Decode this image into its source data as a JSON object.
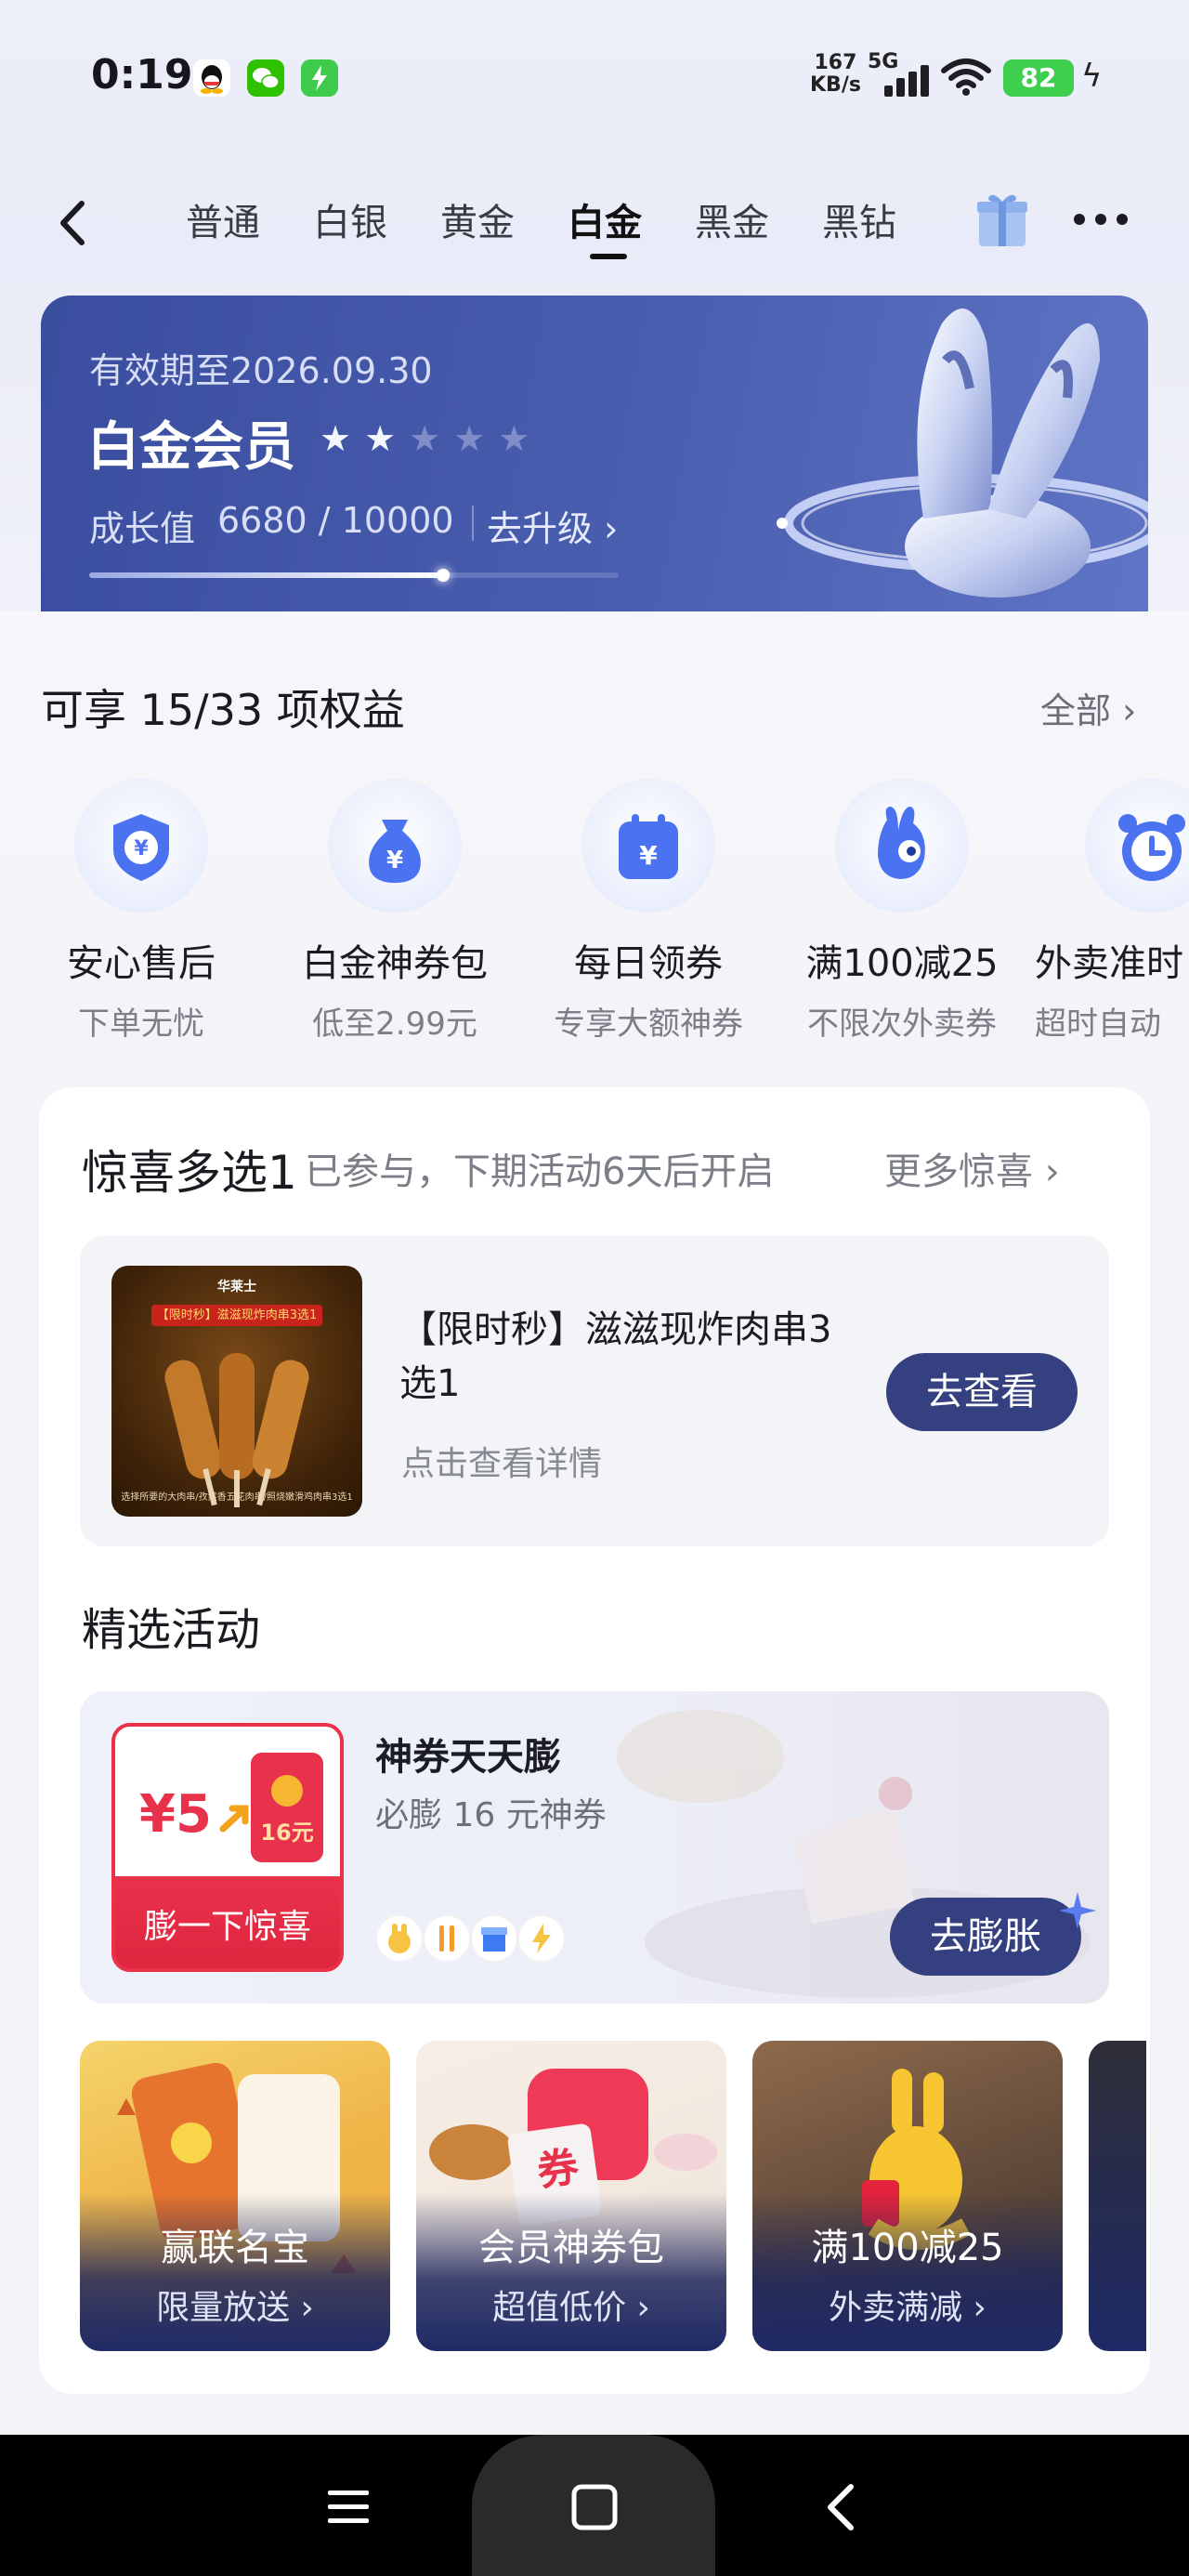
{
  "status_bar": {
    "time": "0:19",
    "net_speed_value": "167",
    "net_speed_unit": "KB/s",
    "network": "5G",
    "battery": "82"
  },
  "nav": {
    "tabs": [
      {
        "label": "普通"
      },
      {
        "label": "白银"
      },
      {
        "label": "黄金"
      },
      {
        "label": "白金"
      },
      {
        "label": "黑金"
      },
      {
        "label": "黑钻"
      }
    ],
    "active_tab": "白金"
  },
  "member_card": {
    "valid_until": "有效期至2026.09.30",
    "title": "白金会员",
    "stars_filled": 2,
    "stars_total": 5,
    "growth_label": "成长值",
    "growth_value": "6680 / 10000",
    "growth_progress": 0.668,
    "upgrade_label": "去升级",
    "chevron": "›"
  },
  "benefits": {
    "title": "可享 15/33 项权益",
    "all_label": "全部",
    "chevron": "›",
    "items": [
      {
        "name": "安心售后",
        "sub": "下单无忧",
        "icon": "shield-yen-icon"
      },
      {
        "name": "白金神券包",
        "sub": "低至2.99元",
        "icon": "money-bag-icon"
      },
      {
        "name": "每日领券",
        "sub": "专享大额神券",
        "icon": "calendar-yen-icon"
      },
      {
        "name": "满100减25",
        "sub": "不限次外卖券",
        "icon": "mascot-icon"
      },
      {
        "name": "外卖准时",
        "sub": "超时自动",
        "icon": "alarm-clock-icon"
      }
    ]
  },
  "surprise": {
    "title": "惊喜多选1",
    "status": "已参与，下期活动6天后开启",
    "more_label": "更多惊喜",
    "chevron": "›",
    "deal": {
      "name": "【限时秒】滋滋现炸肉串3选1",
      "sub": "点击查看详情",
      "button": "去查看",
      "img_brand": "华莱士",
      "img_banner": "【限时秒】滋滋现炸肉串3选1",
      "img_caption": "选择所要的大肉串/孜然香五花肉串/照烧嫩滑鸡肉串3选1"
    }
  },
  "featured": {
    "title": "精选活动",
    "promo": {
      "title": "神券天天膨",
      "sub": "必膨 16 元神券",
      "tile_from": "¥5",
      "tile_to": "16元",
      "tile_label": "膨一下惊喜",
      "button": "去膨胀"
    },
    "cards": [
      {
        "title": "赢联名宝",
        "sub": "限量放送"
      },
      {
        "title": "会员神券包",
        "sub": "超值低价",
        "badge": "券"
      },
      {
        "title": "满100减25",
        "sub": "外卖满减"
      }
    ]
  },
  "colors": {
    "accent": "#34407f",
    "card": "#4a5eb0",
    "red": "#e8314b"
  }
}
